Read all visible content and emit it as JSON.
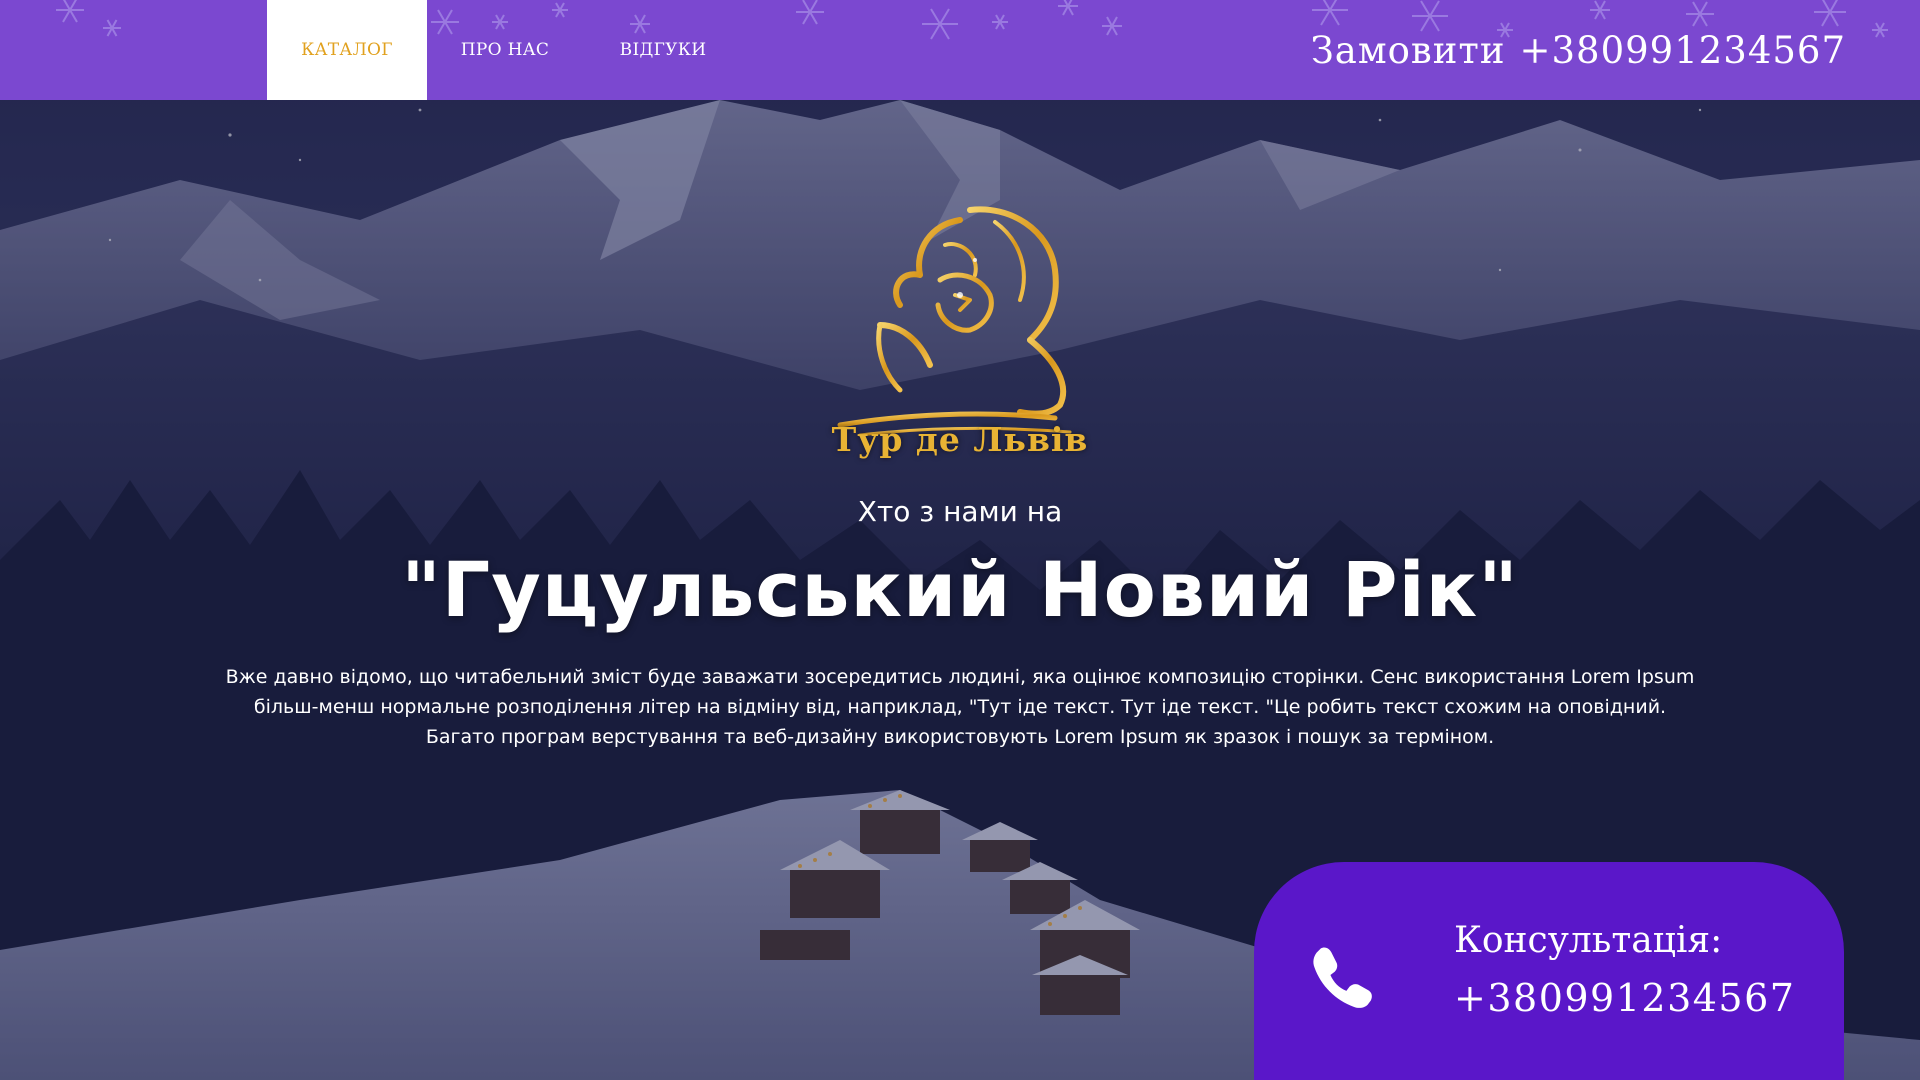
{
  "nav": {
    "items": [
      {
        "label": "КАТАЛОГ",
        "active": true
      },
      {
        "label": "ПРО НАС",
        "active": false
      },
      {
        "label": "ВІДГУКИ",
        "active": false
      }
    ],
    "order_label": "Замовити",
    "order_phone": "+380991234567"
  },
  "logo": {
    "text": "Тур де Львів",
    "icon": "lion-icon"
  },
  "hero": {
    "subtitle": "Хто з нами на",
    "title": "\"Гуцульський Новий Рік\"",
    "description": [
      "Вже давно відомо, що читабельний зміст буде заважати зосередитись людині, яка оцінює композицію сторінки. Сенс використання Lorem Ipsum",
      "більш-менш нормальне розподілення літер на відміну від, наприклад, \"Тут іде текст. Тут іде текст. \"Це робить текст схожим на оповідний.",
      "Багато програм верстування та веб-дизайну використовують Lorem Ipsum як зразок і пошук за терміном."
    ]
  },
  "consultation": {
    "label": "Консультація:",
    "phone": "+380991234567",
    "icon": "phone-icon"
  },
  "colors": {
    "nav_bg": "#7b48d0",
    "nav_active_text": "#e1a11e",
    "consult_bg": "#5a17c9",
    "logo_gold": "#e8b334"
  }
}
